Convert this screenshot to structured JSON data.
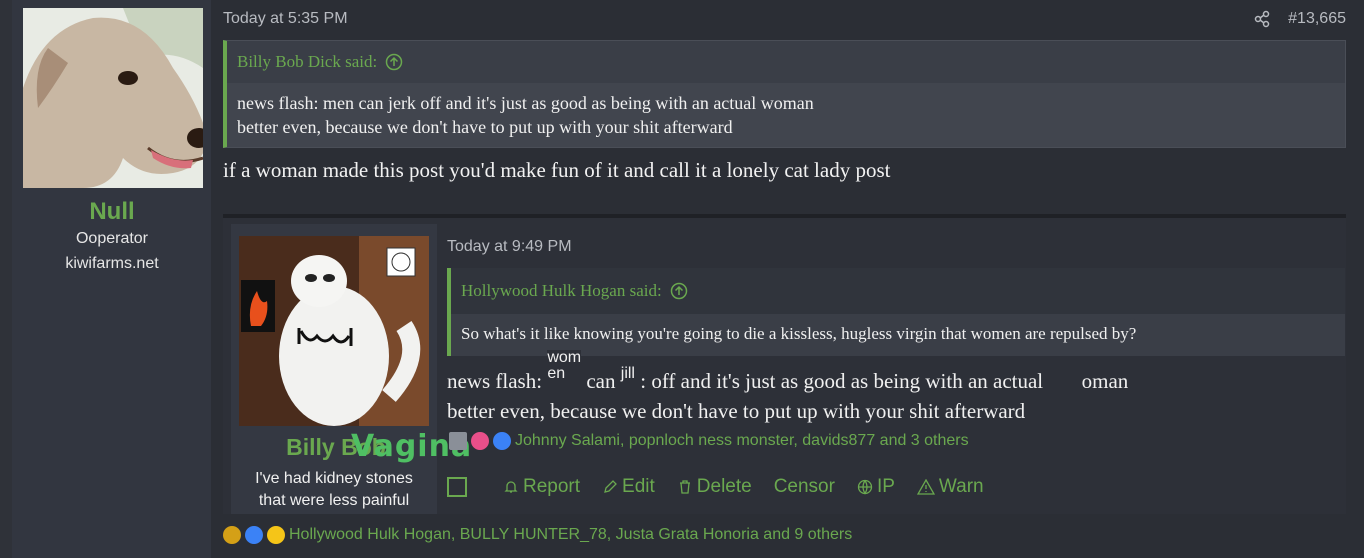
{
  "user": {
    "name": "Null",
    "title": "Ooperator",
    "site": "kiwifarms.net"
  },
  "post": {
    "timestamp": "Today at 5:35 PM",
    "number": "#13,665",
    "quote": {
      "author": "Billy Bob Dick said:",
      "lines": [
        "news flash: men can jerk off and it's just as good as being with an actual woman",
        "better even, because we don't have to put up with your shit afterward"
      ]
    },
    "reply": "if a woman made this post you'd make fun of it and call it a lonely cat lady post",
    "reactions": "Hollywood Hulk Hogan, BULLY HUNTER_78, Justa Grata Honoria and 9 others"
  },
  "embed": {
    "user_name": "Billy Bob",
    "overlay_text": "Vagina",
    "user_title": [
      "I've had kidney stones",
      "that were less painful"
    ],
    "timestamp": "Today at 9:49 PM",
    "quote_author": "Hollywood Hulk Hogan said:",
    "quote_text": "So what's it like knowing you're going to die a kissless, hugless virgin that women are repulsed by?",
    "body_line1_a": "news flash:",
    "overlay_wom": "wom",
    "overlay_en": "en",
    "body_line1_b": "can",
    "overlay_jill": "jill",
    "body_line1_c": ": off and it's just as good as being with an actual",
    "body_line1_d": "oman",
    "body_line2": "better even, because we don't have to put up with your shit afterward",
    "reactions": "Johnny Salami, popnloch ness monster, davids877 and 3 others",
    "actions": {
      "report": "Report",
      "edit": "Edit",
      "delete": "Delete",
      "censor": "Censor",
      "ip": "IP",
      "warn": "Warn"
    }
  },
  "colors": {
    "accent_green": "#6aa84f",
    "background": "#2b2e35"
  }
}
